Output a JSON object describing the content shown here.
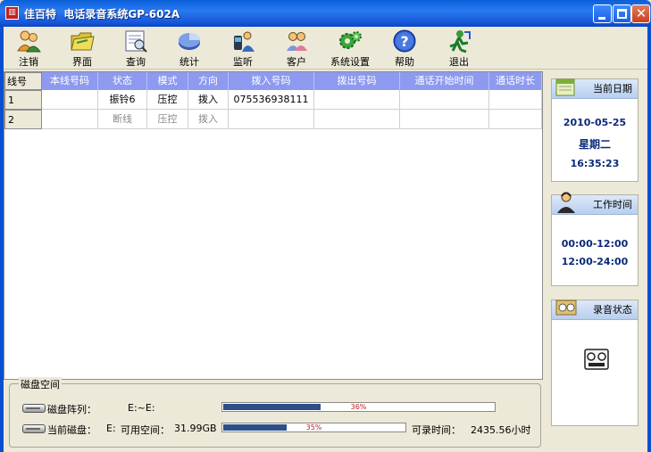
{
  "window": {
    "title": "佳百特  电话录音系统GP-602A",
    "app_icon": "app-logo-icon",
    "buttons": [
      "minimize",
      "maximize",
      "close"
    ]
  },
  "toolbar": {
    "items": [
      {
        "label": "注销",
        "icon": "users-logout-icon"
      },
      {
        "label": "界面",
        "icon": "folder-icon"
      },
      {
        "label": "查询",
        "icon": "search-document-icon"
      },
      {
        "label": "统计",
        "icon": "pie-chart-icon"
      },
      {
        "label": "监听",
        "icon": "headset-listen-icon"
      },
      {
        "label": "客户",
        "icon": "customers-icon"
      },
      {
        "label": "系统设置",
        "icon": "gears-icon"
      },
      {
        "label": "帮助",
        "icon": "help-icon"
      },
      {
        "label": "退出",
        "icon": "exit-icon"
      }
    ]
  },
  "table": {
    "columns": [
      "线号",
      "本线号码",
      "状态",
      "模式",
      "方向",
      "拨入号码",
      "拨出号码",
      "通话开始时间",
      "通话时长"
    ],
    "rows": [
      {
        "line": "1",
        "local_number": "",
        "status": "振铃6",
        "mode": "压控",
        "direction": "拨入",
        "incoming": "075536938111",
        "outgoing": "",
        "start_time": "",
        "duration": "",
        "active": true
      },
      {
        "line": "2",
        "local_number": "",
        "status": "断线",
        "mode": "压控",
        "direction": "拨入",
        "incoming": "",
        "outgoing": "",
        "start_time": "",
        "duration": "",
        "active": false
      }
    ]
  },
  "disk": {
    "legend": "磁盘空间",
    "array_label": "磁盘阵列：",
    "array_value": "E:~E:",
    "array_percent": 36,
    "array_percent_text": "36%",
    "current_label": "当前磁盘：",
    "current_drive": "E:",
    "free_label": "可用空间：",
    "free_value": "31.99GB",
    "current_percent": 35,
    "current_percent_text": "35%",
    "record_time_label": "可录时间：",
    "record_time_value": "2435.56小时"
  },
  "sidebar": {
    "date_card": {
      "title": "当前日期",
      "icon": "calendar-icon",
      "date": "2010-05-25",
      "weekday": "星期二",
      "time": "16:35:23"
    },
    "work_card": {
      "title": "工作时间",
      "icon": "operator-icon",
      "slot1": "00:00-12:00",
      "slot2": "12:00-24:00"
    },
    "record_card": {
      "title": "录音状态",
      "icon": "recorder-icon",
      "status_icon": "tape-recorder-icon"
    }
  },
  "colors": {
    "titlebar": "#0a5fd8",
    "header_bg": "#8d9af0",
    "progress_fill": "#2d4f8a",
    "sidebar_text": "#0a2a7a"
  }
}
